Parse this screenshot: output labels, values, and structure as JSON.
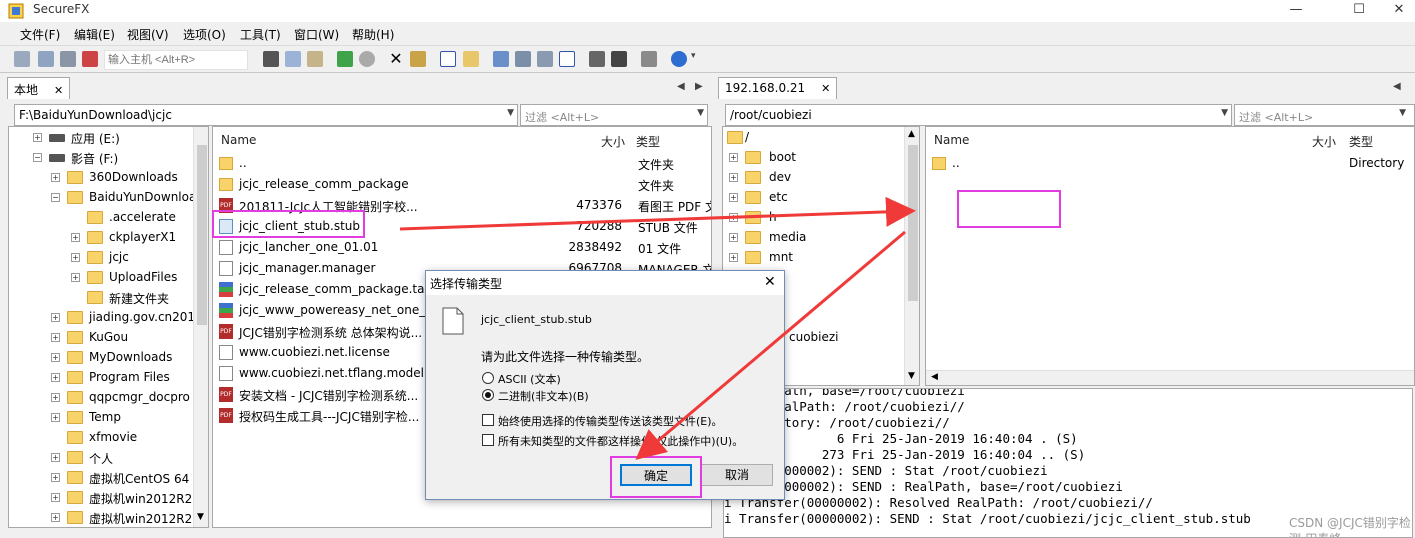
{
  "app": {
    "title": "SecureFX"
  },
  "window_controls": {
    "minimize": "—",
    "maximize": "☐",
    "close": "✕"
  },
  "menu": [
    "文件(F)",
    "编辑(E)",
    "视图(V)",
    "选项(O)",
    "工具(T)",
    "窗口(W)",
    "帮助(H)"
  ],
  "toolbar": {
    "host_placeholder": "输入主机 <Alt+R>"
  },
  "left": {
    "tab": "本地",
    "tab_close": "✕",
    "path": "F:\\BaiduYunDownload\\jcjc",
    "filter": "过滤 <Alt+L>",
    "tree": [
      {
        "label": "应用 (E:)",
        "type": "drive",
        "level": 1,
        "exp": "+"
      },
      {
        "label": "影音 (F:)",
        "type": "drive",
        "level": 1,
        "exp": "−"
      },
      {
        "label": "360Downloads",
        "type": "folder",
        "level": 2,
        "exp": "+"
      },
      {
        "label": "BaiduYunDownloa",
        "type": "folder",
        "level": 2,
        "exp": "−"
      },
      {
        "label": ".accelerate",
        "type": "folder",
        "level": 3,
        "exp": ""
      },
      {
        "label": "ckplayerX1",
        "type": "folder",
        "level": 3,
        "exp": "+"
      },
      {
        "label": "jcjc",
        "type": "folder",
        "level": 3,
        "exp": "+"
      },
      {
        "label": "UploadFiles",
        "type": "folder",
        "level": 3,
        "exp": "+"
      },
      {
        "label": "新建文件夹",
        "type": "folder",
        "level": 3,
        "exp": ""
      },
      {
        "label": "jiading.gov.cn201",
        "type": "folder",
        "level": 2,
        "exp": "+"
      },
      {
        "label": "KuGou",
        "type": "folder",
        "level": 2,
        "exp": "+"
      },
      {
        "label": "MyDownloads",
        "type": "folder",
        "level": 2,
        "exp": "+"
      },
      {
        "label": "Program Files",
        "type": "folder",
        "level": 2,
        "exp": "+"
      },
      {
        "label": "qqpcmgr_docpro",
        "type": "folder",
        "level": 2,
        "exp": "+"
      },
      {
        "label": "Temp",
        "type": "folder",
        "level": 2,
        "exp": "+"
      },
      {
        "label": "xfmovie",
        "type": "folder",
        "level": 2,
        "exp": ""
      },
      {
        "label": "个人",
        "type": "folder",
        "level": 2,
        "exp": "+"
      },
      {
        "label": "虚拟机CentOS 64 ·",
        "type": "folder",
        "level": 2,
        "exp": "+"
      },
      {
        "label": "虚拟机win2012R2",
        "type": "folder",
        "level": 2,
        "exp": "+"
      },
      {
        "label": "虚拟机win2012R2",
        "type": "folder",
        "level": 2,
        "exp": "+"
      }
    ],
    "columns": {
      "name": "Name",
      "size": "大小",
      "type": "类型"
    },
    "files": [
      {
        "name": "..",
        "size": "",
        "type": "文件夹",
        "icon": "folder"
      },
      {
        "name": "jcjc_release_comm_package",
        "size": "",
        "type": "文件夹",
        "icon": "folder"
      },
      {
        "name": "201811-JcJc人工智能错别字校...",
        "size": "473376",
        "type": "看图王 PDF 文",
        "icon": "pdf"
      },
      {
        "name": "jcjc_client_stub.stub",
        "size": "720288",
        "type": "STUB 文件",
        "icon": "stub"
      },
      {
        "name": "jcjc_lancher_one_01.01",
        "size": "2838492",
        "type": "01 文件",
        "icon": "doc"
      },
      {
        "name": "jcjc_manager.manager",
        "size": "6967708",
        "type": "MANAGER 文",
        "icon": "doc"
      },
      {
        "name": "jcjc_release_comm_package.ta...",
        "size": "",
        "type": "",
        "icon": "rar"
      },
      {
        "name": "jcjc_www_powereasy_net_one_...",
        "size": "",
        "type": "",
        "icon": "rar"
      },
      {
        "name": "JCJC错别字检测系统 总体架构说...",
        "size": "",
        "type": "",
        "icon": "pdf"
      },
      {
        "name": "www.cuobiezi.net.license",
        "size": "",
        "type": "",
        "icon": "doc"
      },
      {
        "name": "www.cuobiezi.net.tflang.model",
        "size": "",
        "type": "",
        "icon": "doc"
      },
      {
        "name": "安装文档 - JCJC错别字检测系统...",
        "size": "",
        "type": "",
        "icon": "pdf"
      },
      {
        "name": "授权码生成工具---JCJC错别字检...",
        "size": "",
        "type": "",
        "icon": "pdf"
      }
    ]
  },
  "right": {
    "tab": "192.168.0.21",
    "tab_close": "✕",
    "path": "/root/cuobiezi",
    "filter": "过滤 <Alt+L>",
    "tree": [
      {
        "label": "/",
        "level": 0
      },
      {
        "label": "boot",
        "level": 1
      },
      {
        "label": "dev",
        "level": 1
      },
      {
        "label": "etc",
        "level": 1
      },
      {
        "label": "h",
        "level": 1
      },
      {
        "label": "media",
        "level": 1
      },
      {
        "label": "mnt",
        "level": 1
      },
      {
        "label": "o",
        "level": 1
      },
      {
        "label": "c",
        "level": 1
      },
      {
        "label": "r",
        "level": 1
      },
      {
        "label": "cuobiezi",
        "level": 2
      }
    ],
    "columns": {
      "name": "Name",
      "size": "大小",
      "type": "类型"
    },
    "files": [
      {
        "name": "..",
        "type": "Directory"
      }
    ]
  },
  "log": [
    "   RealPath, base=/root/cuobiezi",
    "   ed RealPath: /root/cuobiezi//",
    "   directory: /root/cuobiezi//",
    "   xr-x        6 Fri 25-Jan-2019 16:40:04 . (S)",
    "   x---      273 Fri 25-Jan-2019 16:40:04 .. (S)",
    "   er(00000002): SEND : Stat /root/cuobiezi",
    "   er(00000002): SEND : RealPath, base=/root/cuobiezi",
    "i Transfer(00000002): Resolved RealPath: /root/cuobiezi//",
    "i Transfer(00000002): SEND : Stat /root/cuobiezi/jcjc_client_stub.stub"
  ],
  "dialog": {
    "title": "选择传输类型",
    "close": "✕",
    "filename": "jcjc_client_stub.stub",
    "prompt": "请为此文件选择一种传输类型。",
    "options": [
      "ASCII (文本)",
      "二进制(非文本)(B)"
    ],
    "selected_option": "二进制(非文本)(B)",
    "checks": [
      "始终使用选择的传输类型传送该类型文件(E)。",
      "所有未知类型的文件都这样操作(仅此操作中)(U)。"
    ],
    "ok": "确定",
    "cancel": "取消"
  },
  "watermark": "CSDN @JCJC错别字检测-田春峰",
  "colors": {
    "highlight": "#e03ce0",
    "arrow": "#f03a3a"
  }
}
